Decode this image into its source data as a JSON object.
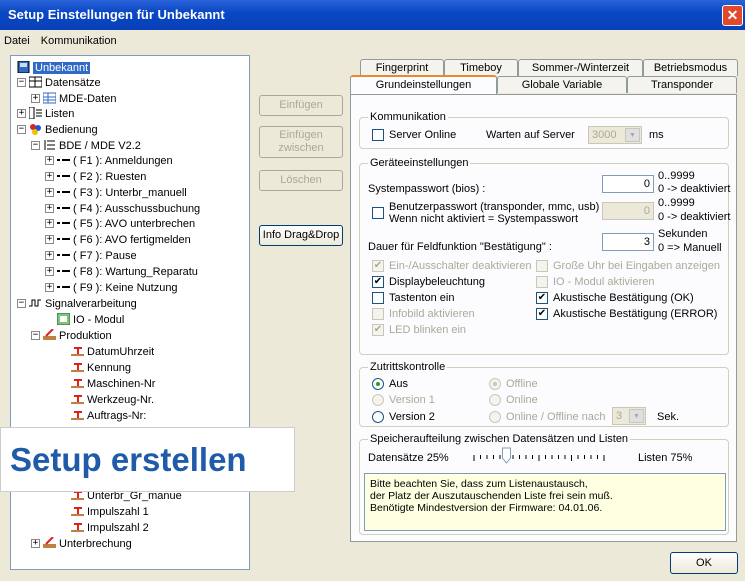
{
  "window": {
    "title": "Setup Einstellungen für Unbekannt",
    "close_glyph": "✕"
  },
  "menu": [
    "Datei",
    "Kommunikation"
  ],
  "tree": [
    {
      "label": "Unbekannt",
      "icon": "device-icon",
      "sign": ""
    },
    {
      "label": "Datensätze",
      "icon": "database-icon",
      "sign": "−"
    },
    {
      "label": "MDE-Daten",
      "icon": "table-icon",
      "sign": "+"
    },
    {
      "label": "Listen",
      "icon": "list-icon",
      "sign": "+"
    },
    {
      "label": "Bedienung",
      "icon": "color-icon",
      "sign": "−"
    },
    {
      "label": "BDE / MDE V2.2",
      "icon": "menu-icon",
      "sign": "−"
    },
    {
      "label": "( F1 ): Anmeldungen",
      "icon": "key-icon",
      "sign": "+"
    },
    {
      "label": "( F2 ): Ruesten",
      "icon": "key-icon",
      "sign": "+"
    },
    {
      "label": "( F3 ): Unterbr_manuell",
      "icon": "key-icon",
      "sign": "+"
    },
    {
      "label": "( F4 ): Ausschussbuchung",
      "icon": "key-icon",
      "sign": "+"
    },
    {
      "label": "( F5 ): AVO unterbrechen",
      "icon": "key-icon",
      "sign": "+"
    },
    {
      "label": "( F6 ): AVO fertigmelden",
      "icon": "key-icon",
      "sign": "+"
    },
    {
      "label": "( F7 ): Pause",
      "icon": "key-icon",
      "sign": "+"
    },
    {
      "label": "( F8 ): Wartung_Reparatu",
      "icon": "key-icon",
      "sign": "+"
    },
    {
      "label": "( F9 ): Keine Nutzung",
      "icon": "key-icon",
      "sign": "+"
    },
    {
      "label": "Signalverarbeitung",
      "icon": "signal-icon",
      "sign": "−"
    },
    {
      "label": "IO - Modul",
      "icon": "io-icon",
      "sign": ""
    },
    {
      "label": "Produktion",
      "icon": "production-icon",
      "sign": "−"
    },
    {
      "label": "DatumUhrzeit",
      "icon": "field-icon",
      "sign": ""
    },
    {
      "label": "Kennung",
      "icon": "field-icon",
      "sign": ""
    },
    {
      "label": "Maschinen-Nr",
      "icon": "field-icon",
      "sign": ""
    },
    {
      "label": "Werkzeug-Nr.",
      "icon": "field-icon",
      "sign": ""
    },
    {
      "label": "Auftrags-Nr:",
      "icon": "field-icon",
      "sign": ""
    },
    {
      "label": "Unterbr_Gr_manue",
      "icon": "field-icon",
      "sign": ""
    },
    {
      "label": "Impulszahl 1",
      "icon": "field-icon",
      "sign": ""
    },
    {
      "label": "Impulszahl 2",
      "icon": "field-icon",
      "sign": ""
    },
    {
      "label": "Unterbrechung",
      "icon": "production-icon",
      "sign": "+"
    }
  ],
  "overlay_text": "Setup erstellen",
  "buttons": {
    "insert": "Einfügen",
    "insert_between": "Einfügen zwischen",
    "delete": "Löschen",
    "info": "Info Drag&Drop",
    "ok": "OK"
  },
  "tabs_row1": [
    "Fingerprint",
    "Timeboy",
    "Sommer-/Winterzeit",
    "Betriebsmodus"
  ],
  "tabs_row2": [
    "Grundeinstellungen",
    "Globale Variable",
    "Transponder"
  ],
  "kommunikation": {
    "legend": "Kommunikation",
    "server_online": "Server Online",
    "warten": "Warten auf Server",
    "warten_value": "3000",
    "unit": "ms"
  },
  "geraet": {
    "legend": "Geräteeinstellungen",
    "syspw_label": "Systempasswort (bios) :",
    "syspw_value": "0",
    "syspw_hint1": "0..9999",
    "syspw_hint2": "0 -> deaktiviert",
    "userpw_label1": "Benutzerpasswort (transponder, mmc, usb) :",
    "userpw_label2": "Wenn nicht aktiviert = Systempasswort",
    "userpw_value": "0",
    "userpw_hint1": "0..9999",
    "userpw_hint2": "0 -> deaktiviert",
    "dauer_label": "Dauer für Feldfunktion \"Bestätigung\" :",
    "dauer_value": "3",
    "dauer_hint1": "Sekunden",
    "dauer_hint2": "0 => Manuell",
    "checks": [
      {
        "label": "Ein-/Ausschalter deaktivieren",
        "checked": true,
        "disabled": true
      },
      {
        "label": "Große Uhr bei Eingaben anzeigen",
        "checked": false,
        "disabled": true
      },
      {
        "label": "Displaybeleuchtung",
        "checked": true,
        "disabled": false
      },
      {
        "label": "IO - Modul aktivieren",
        "checked": false,
        "disabled": true
      },
      {
        "label": "Tastenton ein",
        "checked": false,
        "disabled": false
      },
      {
        "label": "Akustische Bestätigung (OK)",
        "checked": true,
        "disabled": false
      },
      {
        "label": "Infobild aktivieren",
        "checked": false,
        "disabled": true
      },
      {
        "label": "Akustische Bestätigung (ERROR)",
        "checked": true,
        "disabled": false
      },
      {
        "label": "LED blinken ein",
        "checked": true,
        "disabled": true
      }
    ]
  },
  "zutritt": {
    "legend": "Zutrittskontrolle",
    "aus": "Aus",
    "v1": "Version 1",
    "v2": "Version 2",
    "offline": "Offline",
    "online": "Online",
    "onoff": "Online / Offline nach",
    "onoff_value": "3",
    "unit": "Sek."
  },
  "speicher": {
    "legend": "Speicheraufteilung zwischen Datensätzen und Listen",
    "left": "Datensätze 25%",
    "right": "Listen 75%",
    "position": 0.25,
    "note1": "Bitte beachten Sie, dass zum Listenaustausch,",
    "note2": "der Platz der Auszutauschenden Liste frei sein muß.",
    "note3": "Benötigte Mindestversion der Firmware: 04.01.06."
  }
}
